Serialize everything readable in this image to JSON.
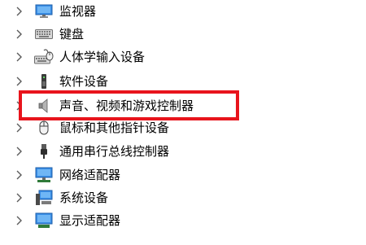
{
  "device_tree": {
    "items": [
      {
        "label": "监视器",
        "icon": "monitor-icon"
      },
      {
        "label": "键盘",
        "icon": "keyboard-icon"
      },
      {
        "label": "人体学输入设备",
        "icon": "hid-icon"
      },
      {
        "label": "软件设备",
        "icon": "software-device-icon"
      },
      {
        "label": "声音、视频和游戏控制器",
        "icon": "speaker-icon"
      },
      {
        "label": "鼠标和其他指针设备",
        "icon": "mouse-icon"
      },
      {
        "label": "通用串行总线控制器",
        "icon": "usb-icon"
      },
      {
        "label": "网络适配器",
        "icon": "network-adapter-icon"
      },
      {
        "label": "系统设备",
        "icon": "system-device-icon"
      },
      {
        "label": "显示适配器",
        "icon": "display-adapter-icon"
      }
    ]
  },
  "highlighted_item": "声音、视频和游戏控制器",
  "colors": {
    "highlight_border": "#e8141c",
    "chevron": "#5a5a5a"
  }
}
